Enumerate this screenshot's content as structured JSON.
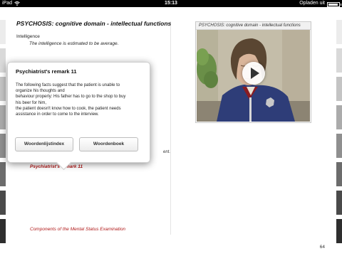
{
  "status_bar": {
    "device": "iPad",
    "time": "15:13",
    "charging_label": "Opladen uit",
    "battery_level": 0.95
  },
  "page": {
    "title": "PSYCHOSIS: cognitive domain - intellectual functions",
    "subheading": "Intelligence",
    "body_text": "The intelligence is estimated to be average.",
    "partial_text": "ent.",
    "remark_link": "Psychiatrist's remark 11",
    "footer_link": "Components of the Mental Status Examination",
    "page_number": "64"
  },
  "video": {
    "title": "PSYCHOSIS: cognitive domain - intellectual functions"
  },
  "popover": {
    "title": "Psychiatrist's remark 11",
    "body_lines": [
      "The following facts suggest that the patient is unable to",
      "organize his thoughts and",
      "behaviour properly: His father has to go to the shop to buy",
      "his beer for him,",
      "the patient doesn't know how to cook, the patient needs",
      "assistance in order to come to the interview."
    ],
    "button_left": "Woordenlijstindex",
    "button_right": "Woordenboek"
  },
  "colors": {
    "link_red": "#b01818",
    "tab_shades": [
      "#ececec",
      "#d9d9d9",
      "#c4c4c4",
      "#ababab",
      "#8f8f8f",
      "#6c6c6c",
      "#4a4a4a",
      "#2e2e2e"
    ]
  }
}
